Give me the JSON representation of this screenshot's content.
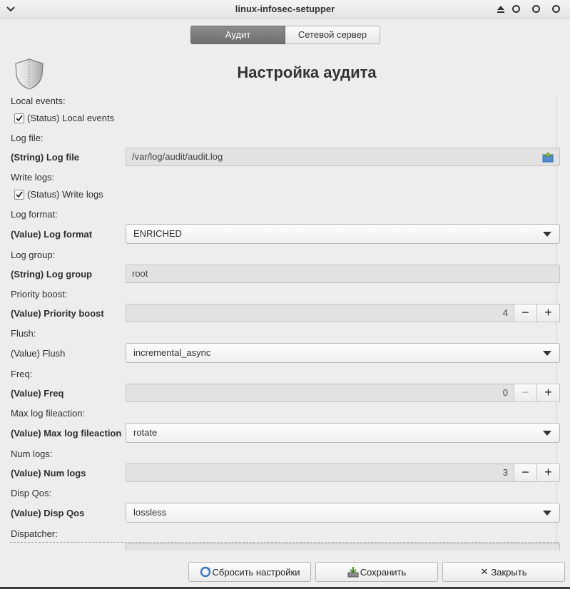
{
  "window": {
    "title": "linux-infosec-setupper"
  },
  "tabs": [
    {
      "label": "Аудит",
      "active": true
    },
    {
      "label": "Сетевой сервер",
      "active": false
    }
  ],
  "page": {
    "heading": "Настройка аудита"
  },
  "form": {
    "local_events": {
      "section": "Local events:",
      "check_label": "(Status) Local events",
      "checked": true
    },
    "log_file": {
      "section": "Log file:",
      "label": "(String) Log file",
      "value": "/var/log/audit/audit.log"
    },
    "write_logs": {
      "section": "Write logs:",
      "check_label": "(Status) Write logs",
      "checked": true
    },
    "log_format": {
      "section": "Log format:",
      "label": "(Value) Log format",
      "value": "ENRICHED"
    },
    "log_group": {
      "section": "Log group:",
      "label": "(String) Log group",
      "value": "root"
    },
    "priority_boost": {
      "section": "Priority boost:",
      "label": "(Value) Priority boost",
      "value": "4",
      "minus": "−",
      "plus": "+"
    },
    "flush": {
      "section": "Flush:",
      "label": "(Value) Flush",
      "value": "incremental_async"
    },
    "freq": {
      "section": "Freq:",
      "label": "(Value) Freq",
      "value": "0",
      "minus": "−",
      "plus": "+"
    },
    "max_log_fileaction": {
      "section": "Max log fileaction:",
      "label": "(Value) Max log fileaction",
      "value": "rotate"
    },
    "num_logs": {
      "section": "Num logs:",
      "label": "(Value) Num logs",
      "value": "3",
      "minus": "−",
      "plus": "+"
    },
    "disp_qos": {
      "section": "Disp Qos:",
      "label": "(Value) Disp Qos",
      "value": "lossless"
    },
    "dispatcher": {
      "section": "Dispatcher:"
    }
  },
  "footer": {
    "reset_label": "Сбросить настройки",
    "save_label": "Сохранить",
    "close_label": "Закрыть",
    "close_glyph": "✕"
  },
  "icons": {
    "menu": "chevron-down-icon",
    "eject": "eject-icon",
    "shield": "shield-icon",
    "file": "folder-open-icon",
    "reset": "refresh-icon",
    "save": "save-icon"
  },
  "colors": {
    "active_tab": "#7d7d7d",
    "background": "#ededed"
  }
}
